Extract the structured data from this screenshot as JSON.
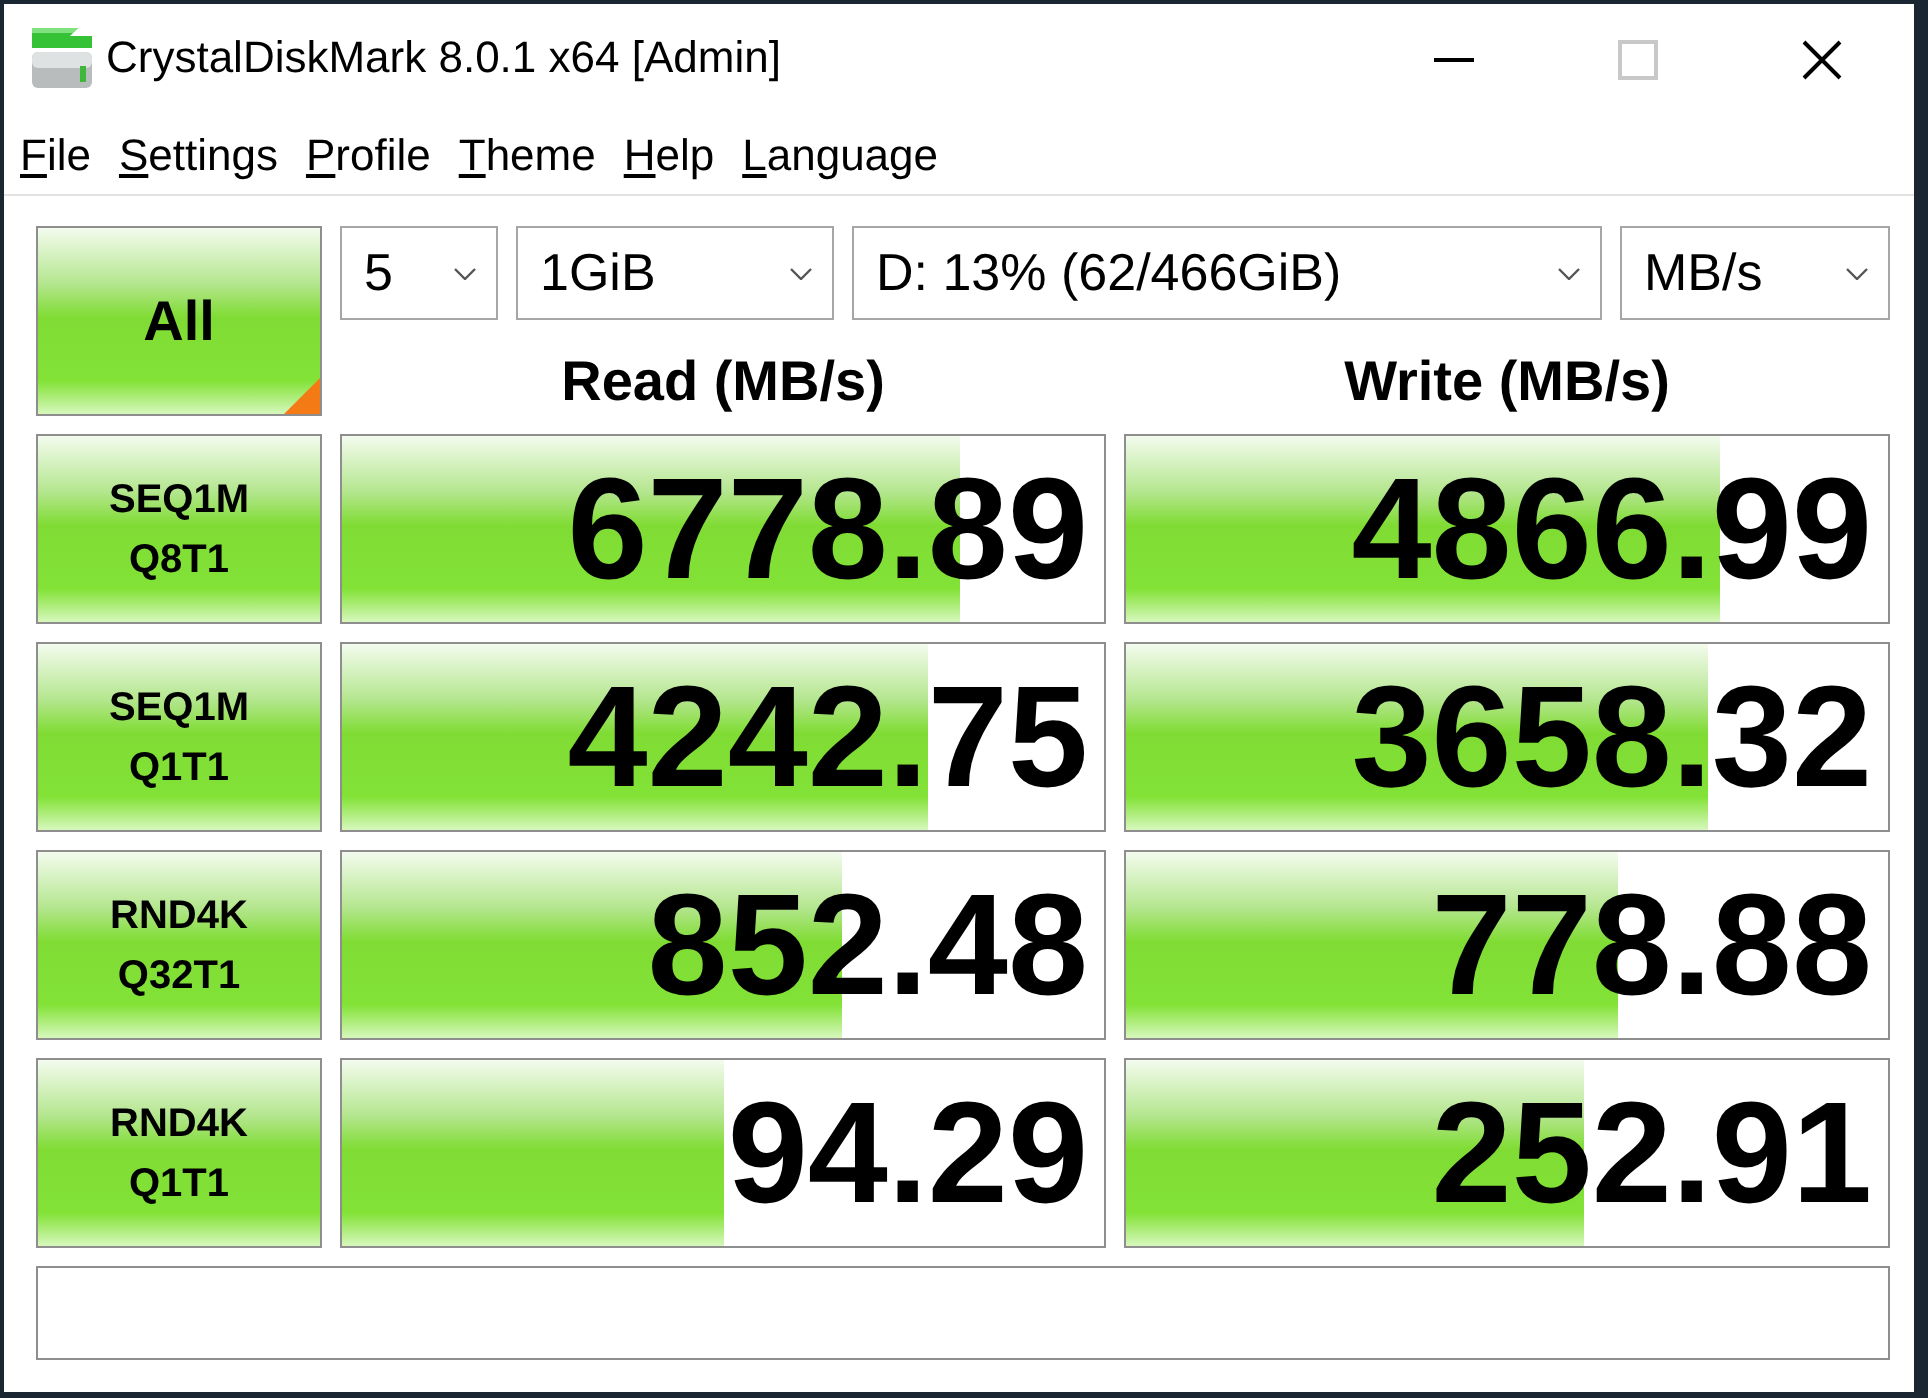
{
  "window": {
    "title": "CrystalDiskMark 8.0.1 x64 [Admin]",
    "controls": [
      {
        "kind": "minimize",
        "disabled": false
      },
      {
        "kind": "maximize",
        "disabled": true
      },
      {
        "kind": "close",
        "disabled": false
      }
    ]
  },
  "menu": [
    {
      "label": "File",
      "access_key_underlined": true
    },
    {
      "label": "Settings",
      "access_key_underlined": true
    },
    {
      "label": "Profile",
      "access_key_underlined": true
    },
    {
      "label": "Theme",
      "access_key_underlined": true
    },
    {
      "label": "Help",
      "access_key_underlined": true
    },
    {
      "label": "Language",
      "access_key_underlined": true
    }
  ],
  "all_button": {
    "label": "All"
  },
  "selects": [
    {
      "kind": "count",
      "value": "5"
    },
    {
      "kind": "size",
      "value": "1GiB"
    },
    {
      "kind": "drive",
      "value": "D: 13% (62/466GiB)"
    },
    {
      "kind": "unit",
      "value": "MB/s"
    }
  ],
  "columns": [
    "Read (MB/s)",
    "Write (MB/s)"
  ],
  "tests": [
    {
      "name": "SEQ1M",
      "params": "Q8T1",
      "results": [
        {
          "value": "6778.89",
          "level": 0.81
        },
        {
          "value": "4866.99",
          "level": 0.78
        }
      ]
    },
    {
      "name": "SEQ1M",
      "params": "Q1T1",
      "results": [
        {
          "value": "4242.75",
          "level": 0.77
        },
        {
          "value": "3658.32",
          "level": 0.765
        }
      ]
    },
    {
      "name": "RND4K",
      "params": "Q32T1",
      "results": [
        {
          "value": "852.48",
          "level": 0.655
        },
        {
          "value": "778.88",
          "level": 0.645
        }
      ]
    },
    {
      "name": "RND4K",
      "params": "Q1T1",
      "results": [
        {
          "value": "94.29",
          "level": 0.5
        },
        {
          "value": "252.91",
          "level": 0.6
        }
      ]
    }
  ]
}
